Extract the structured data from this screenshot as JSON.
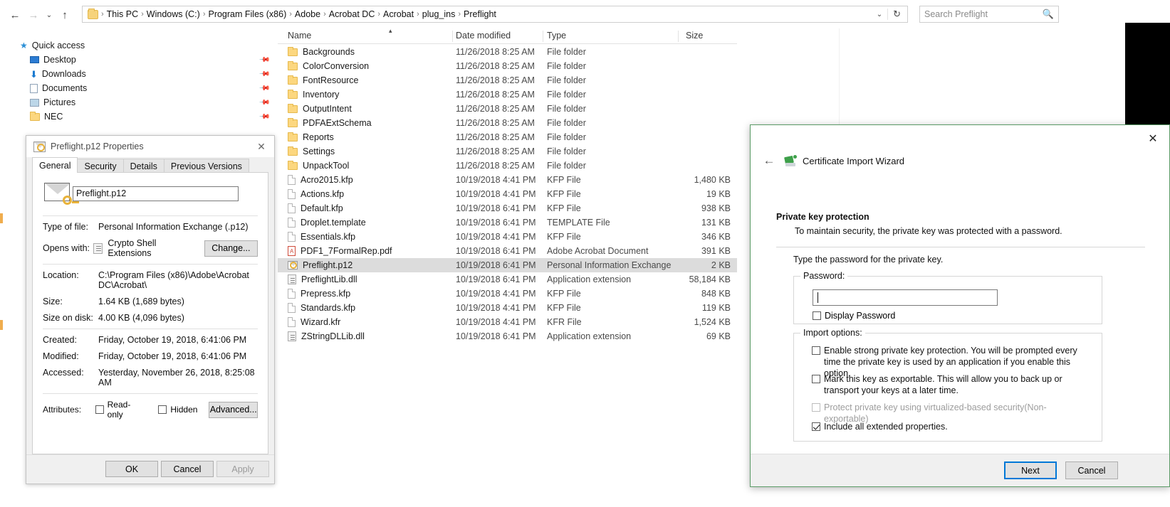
{
  "explorer": {
    "nav": {
      "back": "←",
      "forward": "→",
      "recent": "⌄",
      "up": "↑"
    },
    "address": {
      "crumbs": [
        "This PC",
        "Windows (C:)",
        "Program Files (x86)",
        "Adobe",
        "Acrobat DC",
        "Acrobat",
        "plug_ins",
        "Preflight"
      ],
      "dropdown_icon": "⌄",
      "refresh_icon": "↻"
    },
    "search": {
      "placeholder": "Search Preflight",
      "icon": "search-icon"
    },
    "columns": [
      {
        "label": "Name"
      },
      {
        "label": "Date modified"
      },
      {
        "label": "Type"
      },
      {
        "label": "Size"
      }
    ],
    "sidebar": [
      {
        "label": "Quick access",
        "icon": "pin-star-icon",
        "pinned": false
      },
      {
        "label": "Desktop",
        "icon": "desktop-icon",
        "pinned": true
      },
      {
        "label": "Downloads",
        "icon": "downloads-icon",
        "pinned": true
      },
      {
        "label": "Documents",
        "icon": "documents-icon",
        "pinned": true
      },
      {
        "label": "Pictures",
        "icon": "pictures-icon",
        "pinned": true
      },
      {
        "label": "NEC",
        "icon": "folder-icon",
        "pinned": true
      }
    ],
    "files": [
      {
        "name": "Backgrounds",
        "date": "11/26/2018 8:25 AM",
        "type": "File folder",
        "size": "",
        "icon": "folder",
        "selected": false
      },
      {
        "name": "ColorConversion",
        "date": "11/26/2018 8:25 AM",
        "type": "File folder",
        "size": "",
        "icon": "folder",
        "selected": false
      },
      {
        "name": "FontResource",
        "date": "11/26/2018 8:25 AM",
        "type": "File folder",
        "size": "",
        "icon": "folder",
        "selected": false
      },
      {
        "name": "Inventory",
        "date": "11/26/2018 8:25 AM",
        "type": "File folder",
        "size": "",
        "icon": "folder",
        "selected": false
      },
      {
        "name": "OutputIntent",
        "date": "11/26/2018 8:25 AM",
        "type": "File folder",
        "size": "",
        "icon": "folder",
        "selected": false
      },
      {
        "name": "PDFAExtSchema",
        "date": "11/26/2018 8:25 AM",
        "type": "File folder",
        "size": "",
        "icon": "folder",
        "selected": false
      },
      {
        "name": "Reports",
        "date": "11/26/2018 8:25 AM",
        "type": "File folder",
        "size": "",
        "icon": "folder",
        "selected": false
      },
      {
        "name": "Settings",
        "date": "11/26/2018 8:25 AM",
        "type": "File folder",
        "size": "",
        "icon": "folder",
        "selected": false
      },
      {
        "name": "UnpackTool",
        "date": "11/26/2018 8:25 AM",
        "type": "File folder",
        "size": "",
        "icon": "folder",
        "selected": false
      },
      {
        "name": "Acro2015.kfp",
        "date": "10/19/2018 4:41 PM",
        "type": "KFP File",
        "size": "1,480 KB",
        "icon": "file",
        "selected": false
      },
      {
        "name": "Actions.kfp",
        "date": "10/19/2018 4:41 PM",
        "type": "KFP File",
        "size": "19 KB",
        "icon": "file",
        "selected": false
      },
      {
        "name": "Default.kfp",
        "date": "10/19/2018 6:41 PM",
        "type": "KFP File",
        "size": "938 KB",
        "icon": "file",
        "selected": false
      },
      {
        "name": "Droplet.template",
        "date": "10/19/2018 6:41 PM",
        "type": "TEMPLATE File",
        "size": "131 KB",
        "icon": "file",
        "selected": false
      },
      {
        "name": "Essentials.kfp",
        "date": "10/19/2018 4:41 PM",
        "type": "KFP File",
        "size": "346 KB",
        "icon": "file",
        "selected": false
      },
      {
        "name": "PDF1_7FormalRep.pdf",
        "date": "10/19/2018 6:41 PM",
        "type": "Adobe Acrobat Document",
        "size": "391 KB",
        "icon": "pdf",
        "selected": false
      },
      {
        "name": "Preflight.p12",
        "date": "10/19/2018 6:41 PM",
        "type": "Personal Information Exchange",
        "size": "2 KB",
        "icon": "p12",
        "selected": true
      },
      {
        "name": "PreflightLib.dll",
        "date": "10/19/2018 6:41 PM",
        "type": "Application extension",
        "size": "58,184 KB",
        "icon": "dll",
        "selected": false
      },
      {
        "name": "Prepress.kfp",
        "date": "10/19/2018 4:41 PM",
        "type": "KFP File",
        "size": "848 KB",
        "icon": "file",
        "selected": false
      },
      {
        "name": "Standards.kfp",
        "date": "10/19/2018 4:41 PM",
        "type": "KFP File",
        "size": "119 KB",
        "icon": "file",
        "selected": false
      },
      {
        "name": "Wizard.kfr",
        "date": "10/19/2018 4:41 PM",
        "type": "KFR File",
        "size": "1,524 KB",
        "icon": "file",
        "selected": false
      },
      {
        "name": "ZStringDLLib.dll",
        "date": "10/19/2018 6:41 PM",
        "type": "Application extension",
        "size": "69 KB",
        "icon": "dll",
        "selected": false
      }
    ]
  },
  "properties": {
    "title": "Preflight.p12 Properties",
    "close_icon": "✕",
    "tabs": [
      {
        "label": "General",
        "active": true
      },
      {
        "label": "Security",
        "active": false
      },
      {
        "label": "Details",
        "active": false
      },
      {
        "label": "Previous Versions",
        "active": false
      }
    ],
    "filename_value": "Preflight.p12",
    "fields": [
      {
        "label": "Type of file:",
        "value": "Personal Information Exchange (.p12)"
      },
      {
        "label": "Opens with:",
        "value": "Crypto Shell Extensions"
      },
      {
        "label": "Location:",
        "value": "C:\\Program Files (x86)\\Adobe\\Acrobat DC\\Acrobat\\"
      },
      {
        "label": "Size:",
        "value": "1.64 KB (1,689 bytes)"
      },
      {
        "label": "Size on disk:",
        "value": "4.00 KB (4,096 bytes)"
      },
      {
        "label": "Created:",
        "value": "Friday, October 19, 2018, 6:41:06 PM"
      },
      {
        "label": "Modified:",
        "value": "Friday, October 19, 2018, 6:41:06 PM"
      },
      {
        "label": "Accessed:",
        "value": "Yesterday, November 26, 2018, 8:25:08 AM"
      }
    ],
    "change_button": "Change...",
    "attributes_label": "Attributes:",
    "attributes": [
      {
        "label": "Read-only",
        "checked": false
      },
      {
        "label": "Hidden",
        "checked": false
      }
    ],
    "advanced_button": "Advanced...",
    "buttons": [
      {
        "label": "OK",
        "disabled": false
      },
      {
        "label": "Cancel",
        "disabled": false
      },
      {
        "label": "Apply",
        "disabled": true
      }
    ]
  },
  "wizard": {
    "title": "Certificate Import Wizard",
    "back_icon": "←",
    "close_icon": "✕",
    "heading": "Private key protection",
    "subheading": "To maintain security, the private key was protected with a password.",
    "instruction": "Type the password for the private key.",
    "password_group_label": "Password:",
    "password_value": "",
    "display_password": {
      "label": "Display Password",
      "checked": false
    },
    "import_group_label": "Import options:",
    "options": [
      {
        "label": "Enable strong private key protection. You will be prompted every time the private key is used by an application if you enable this option.",
        "checked": false,
        "disabled": false
      },
      {
        "label": "Mark this key as exportable. This will allow you to back up or transport your keys at a later time.",
        "checked": false,
        "disabled": false
      },
      {
        "label": "Protect private key using virtualized-based security(Non-exportable)",
        "checked": false,
        "disabled": true
      },
      {
        "label": "Include all extended properties.",
        "checked": true,
        "disabled": false
      }
    ],
    "buttons": [
      {
        "label": "Next",
        "primary": true
      },
      {
        "label": "Cancel",
        "primary": false
      }
    ],
    "border_color": "#5b9b67",
    "accent_color": "#0078d7"
  }
}
